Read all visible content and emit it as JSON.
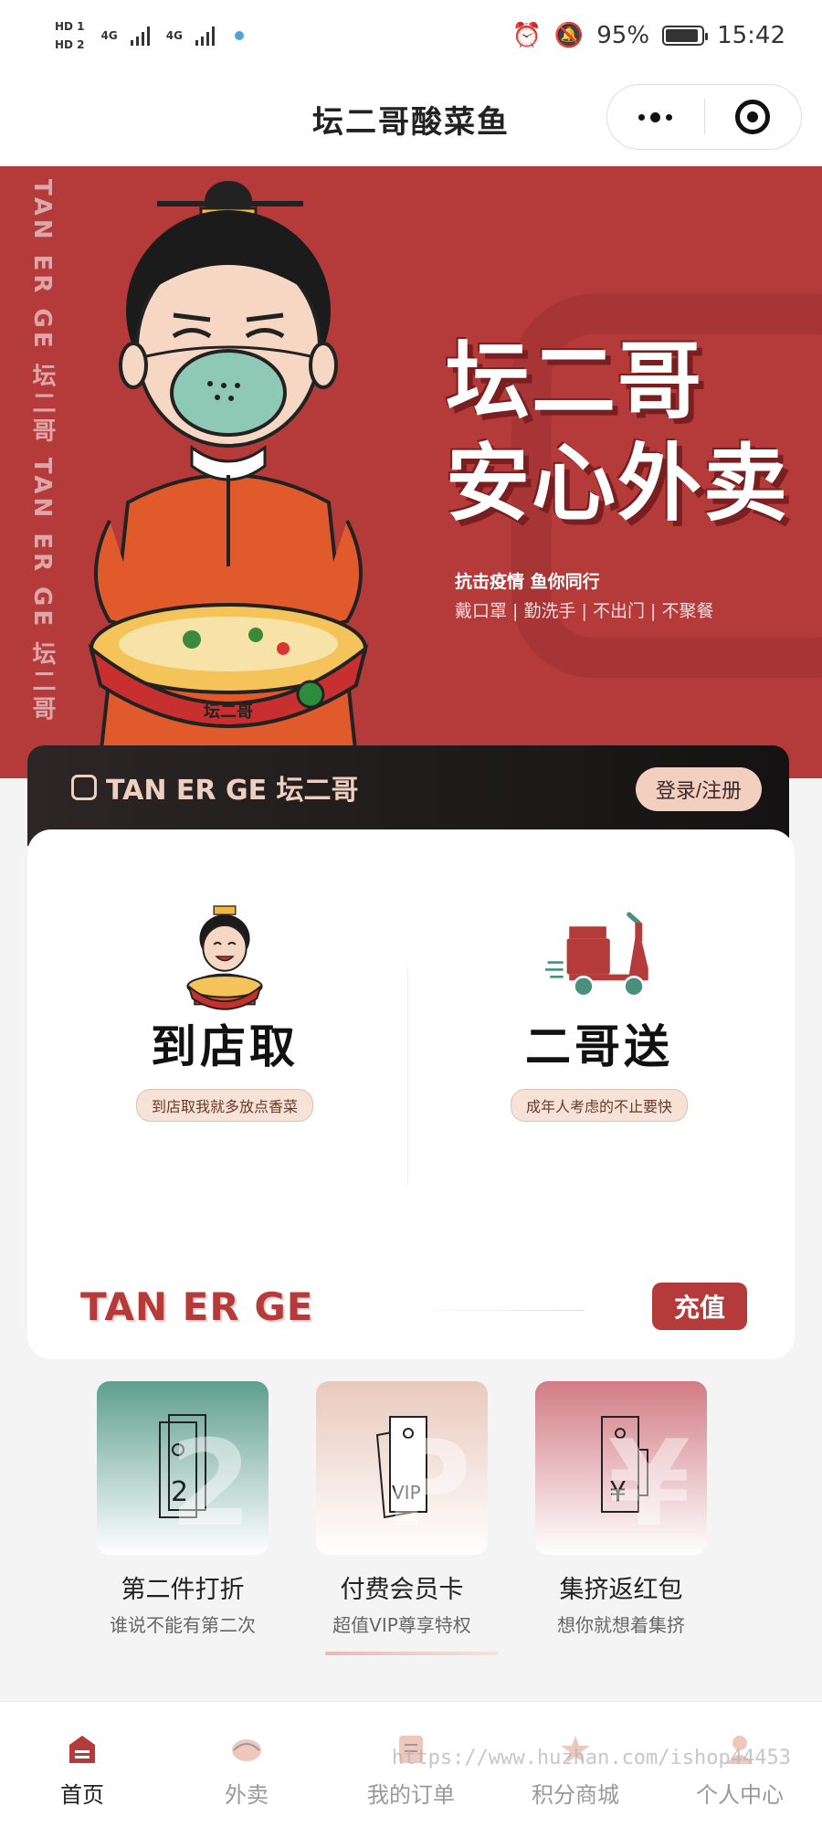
{
  "status_bar": {
    "hd1": "HD 1",
    "hd2": "HD 2",
    "net1": "4G",
    "net2": "4G",
    "battery": "95%",
    "time": "15:42"
  },
  "nav": {
    "title": "坛二哥酸菜鱼"
  },
  "banner": {
    "vertical_brand": "TAN ER GE 坛二哥 TAN ER GE 坛二哥",
    "headline_1": "坛二哥",
    "headline_2": "安心外卖",
    "sub_1": "抗击疫情 鱼你同行",
    "sub_2": "戴口罩 | 勤洗手 | 不出门 | 不聚餐",
    "pot_text": "坛二哥"
  },
  "member": {
    "brand": "TAN ER GE 坛二哥",
    "login_label": "登录/注册"
  },
  "services": [
    {
      "title": "到店取",
      "subtitle": "到店取我就多放点香菜"
    },
    {
      "title": "二哥送",
      "subtitle": "成年人考虑的不止要快"
    }
  ],
  "section": {
    "brand_en": "TAN ER GE",
    "recharge_label": "充值"
  },
  "features": [
    {
      "name": "第二件打折",
      "desc": "谁说不能有第二次",
      "ghost": "2",
      "icon": "second-item-ticket-icon",
      "color_top": "#5f9f8e"
    },
    {
      "name": "付费会员卡",
      "desc": "超值VIP尊享特权",
      "ghost": "P",
      "icon": "vip-card-icon",
      "color_top": "#e9c9bd"
    },
    {
      "name": "集挤返红包",
      "desc": "想你就想着集挤",
      "ghost": "¥",
      "icon": "red-packet-icon",
      "color_top": "#d27c84"
    }
  ],
  "tabbar": [
    {
      "label": "首页",
      "icon": "home-shop-icon",
      "active": true
    },
    {
      "label": "外卖",
      "icon": "delivery-icon",
      "active": false
    },
    {
      "label": "我的订单",
      "icon": "orders-icon",
      "active": false
    },
    {
      "label": "积分商城",
      "icon": "points-star-icon",
      "active": false
    },
    {
      "label": "个人中心",
      "icon": "profile-icon",
      "active": false
    }
  ],
  "watermark": "https://www.huzhan.com/ishop44453",
  "colors": {
    "brand_red": "#b53a3a",
    "dark_bar": "#1c1818",
    "accent_peach": "#f3cfc0"
  }
}
